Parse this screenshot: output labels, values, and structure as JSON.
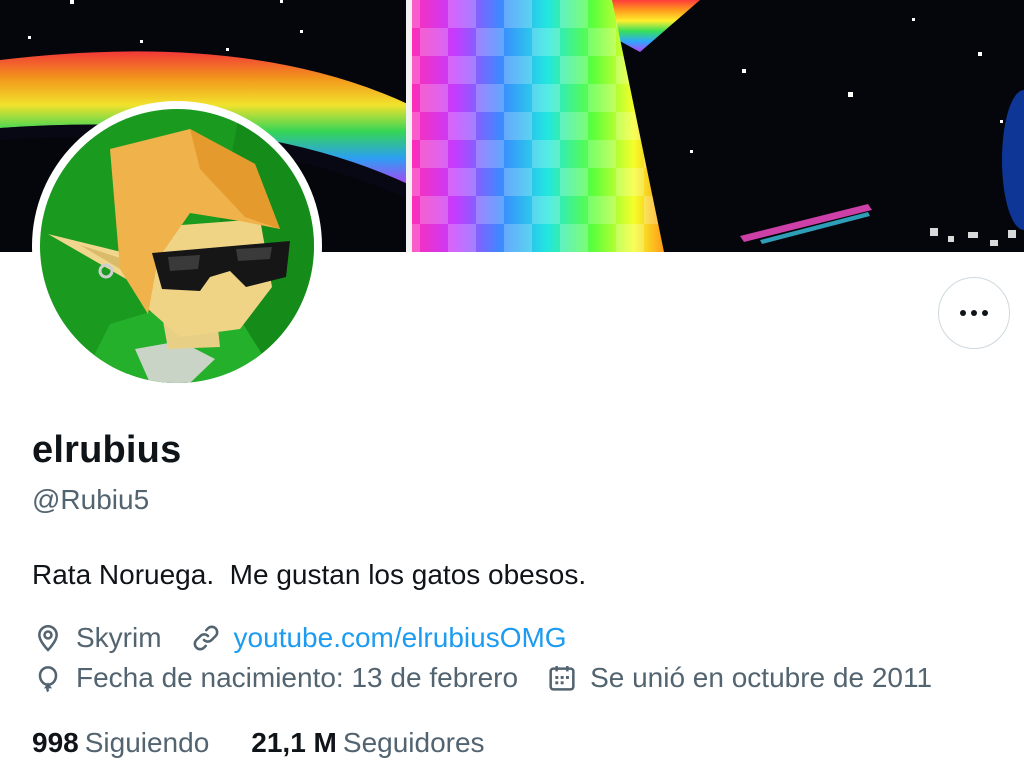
{
  "profile": {
    "display_name": "elrubius",
    "handle": "@Rubiu5",
    "bio": "Rata Noruega.  Me gustan los gatos obesos.",
    "location": "Skyrim",
    "website": "youtube.com/elrubiusOMG",
    "birthday": "Fecha de nacimiento: 13 de febrero",
    "joined": "Se unió en octubre de 2011"
  },
  "stats": {
    "following_count": "998",
    "following_label": "Siguiendo",
    "followers_count": "21,1 M",
    "followers_label": "Seguidores"
  },
  "icons": {
    "more": "more-options-icon",
    "location": "location-pin-icon",
    "link": "link-icon",
    "birthday": "balloon-icon",
    "joined": "calendar-icon"
  },
  "colors": {
    "accent": "#1d9bf0",
    "text_primary": "#0f1419",
    "text_secondary": "#536471"
  }
}
